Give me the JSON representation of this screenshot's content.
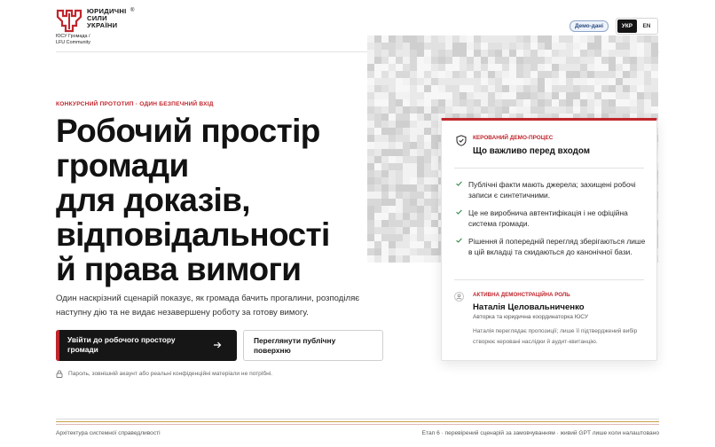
{
  "header": {
    "logo_lines": [
      "ЮРИДИЧНІ",
      "СИЛИ",
      "УКРАЇНИ"
    ],
    "logo_reg": "®",
    "subtitle_line1": "ЮСУ Громада /",
    "subtitle_line2": "LFU Community",
    "demo_badge": "Демо-дані",
    "lang": {
      "active": "УКР",
      "inactive": "EN"
    }
  },
  "hero": {
    "eyebrow": "КОНКУРСНИЙ ПРОТОТИП · ОДИН БЕЗПЕЧНИЙ ВХІД",
    "title_lines": [
      "Робочий простір",
      "громади",
      "для доказів,",
      "відповідальності",
      "й права вимоги"
    ],
    "description": "Один наскрізний сценарій показує, як громада бачить прогалини, розподіляє наступну дію та не видає незавершену роботу за готову вимогу.",
    "primary_button": "Увійти до робочого простору громади",
    "secondary_button": "Переглянути публічну поверхню",
    "lock_note": "Пароль, зовнішній акаунт або реальні конфіденційні матеріали не потрібні."
  },
  "card": {
    "eyebrow": "КЕРОВАНИЙ ДЕМО-ПРОЦЕС",
    "title": "Що важливо перед входом",
    "items": [
      "Публічні факти мають джерела; захищені робочі записи є синтетичними.",
      "Це не виробнича автентифікація і не офіційна система громади.",
      "Рішення й попередній перегляд зберігаються лише в цій вкладці та скидаються до канонічної бази."
    ],
    "role": {
      "eyebrow": "АКТИВНА ДЕМОНСТРАЦІЙНА РОЛЬ",
      "name": "Наталія Целовальниченко",
      "description": "Авторка та юридична координаторка ЮСУ",
      "note": "Наталія переглядає пропозиції; лише її підтверджений вибір створює керовані наслідки й аудит-квитанцію."
    }
  },
  "footer": {
    "left": "Архітектура системної справедливості",
    "right": "Етап 6 · перевірений сценарій за замовчуванням · живий GPT лише коли налаштовано"
  },
  "colors": {
    "accent_red": "#c0262d",
    "dark": "#161616",
    "check_green": "#2f8a4a",
    "footer_gold": "#c9a24a"
  }
}
